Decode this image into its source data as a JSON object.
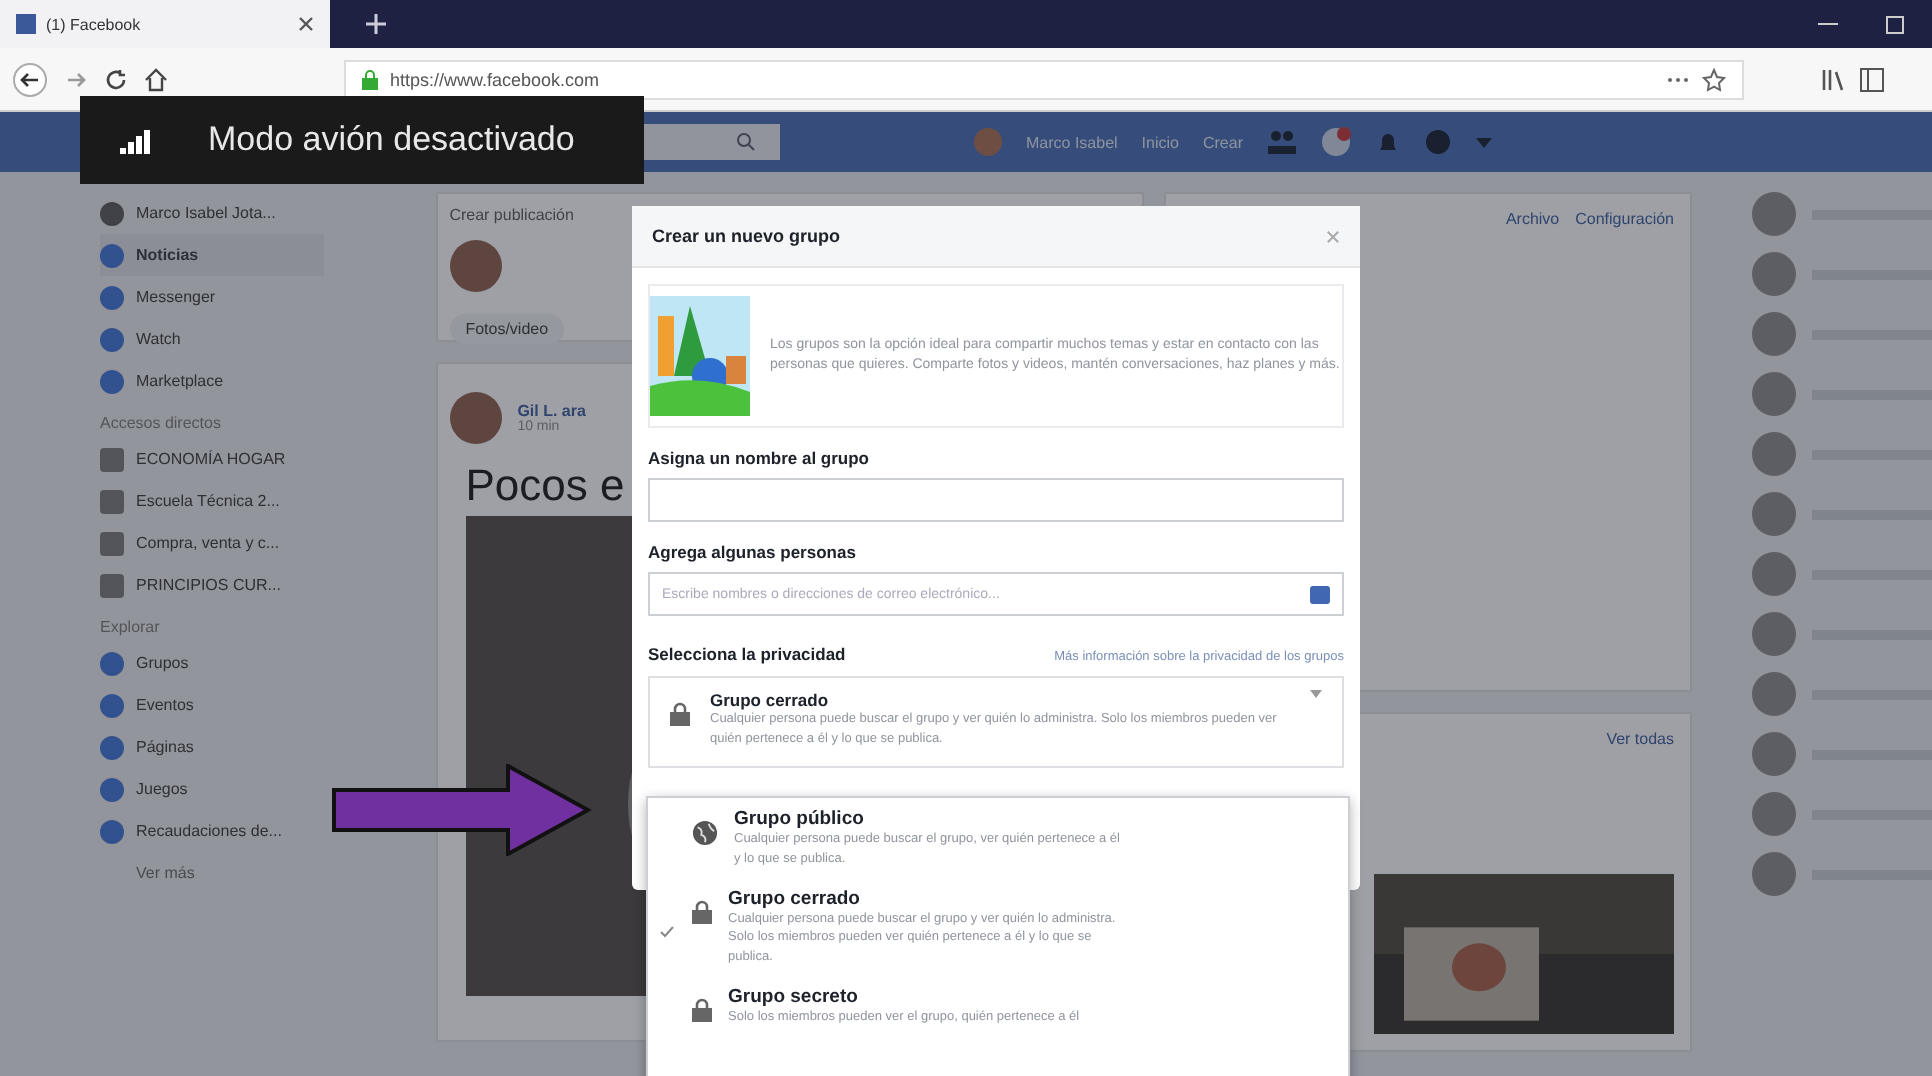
{
  "browser": {
    "tab_title": "(1) Facebook",
    "url": "https://www.facebook.com"
  },
  "toast": {
    "text": "Modo avión desactivado"
  },
  "fb_nav": {
    "user_name": "Marco Isabel",
    "links": [
      "Inicio",
      "Crear"
    ]
  },
  "sidebar": {
    "profile": "Marco Isabel Jota...",
    "items": [
      {
        "label": "Noticias",
        "selected": true
      },
      {
        "label": "Messenger",
        "selected": false
      },
      {
        "label": "Watch",
        "selected": false
      },
      {
        "label": "Marketplace",
        "selected": false
      }
    ],
    "shortcuts_heading": "Accesos directos",
    "shortcuts": [
      "ECONOMÍA HOGAR",
      "Escuela Técnica 2...",
      "Compra, venta y c...",
      "PRINCIPIOS CUR..."
    ],
    "explore_heading": "Explorar",
    "explore": [
      "Grupos",
      "Eventos",
      "Páginas",
      "Juegos",
      "Recaudaciones de..."
    ],
    "more": "Ver más"
  },
  "feed": {
    "composer_title": "Crear publicación",
    "photo_button": "Fotos/video",
    "post_author": "Gil L. ara",
    "post_time": "10 min",
    "post_headline": "Pocos e"
  },
  "right_panel": {
    "links": [
      "Archivo",
      "Configuración"
    ],
    "see_all": "Ver todas"
  },
  "modal": {
    "title": "Crear un nuevo grupo",
    "intro": "Los grupos son la opción ideal para compartir muchos temas y estar en contacto con las personas que quieres. Comparte fotos y videos, mantén conversaciones, haz planes y más.",
    "name_label": "Asigna un nombre al grupo",
    "people_label": "Agrega algunas personas",
    "people_placeholder": "Escribe nombres o direcciones de correo electrónico...",
    "privacy_label": "Selecciona la privacidad",
    "privacy_link": "Más información sobre la privacidad de los grupos",
    "current": {
      "title": "Grupo cerrado",
      "desc": "Cualquier persona puede buscar el grupo y ver quién lo administra. Solo los miembros pueden ver quién pertenece a él y lo que se publica."
    },
    "options": [
      {
        "kind": "globe",
        "title": "Grupo público",
        "desc": "Cualquier persona puede buscar el grupo, ver quién pertenece a él y lo que se publica.",
        "selected": false
      },
      {
        "kind": "lock",
        "title": "Grupo cerrado",
        "desc": "Cualquier persona puede buscar el grupo y ver quién lo administra. Solo los miembros pueden ver quién pertenece a él y lo que se publica.",
        "selected": true
      },
      {
        "kind": "lock",
        "title": "Grupo secreto",
        "desc": "Solo los miembros pueden ver el grupo, quién pertenece a él",
        "selected": false
      }
    ]
  }
}
